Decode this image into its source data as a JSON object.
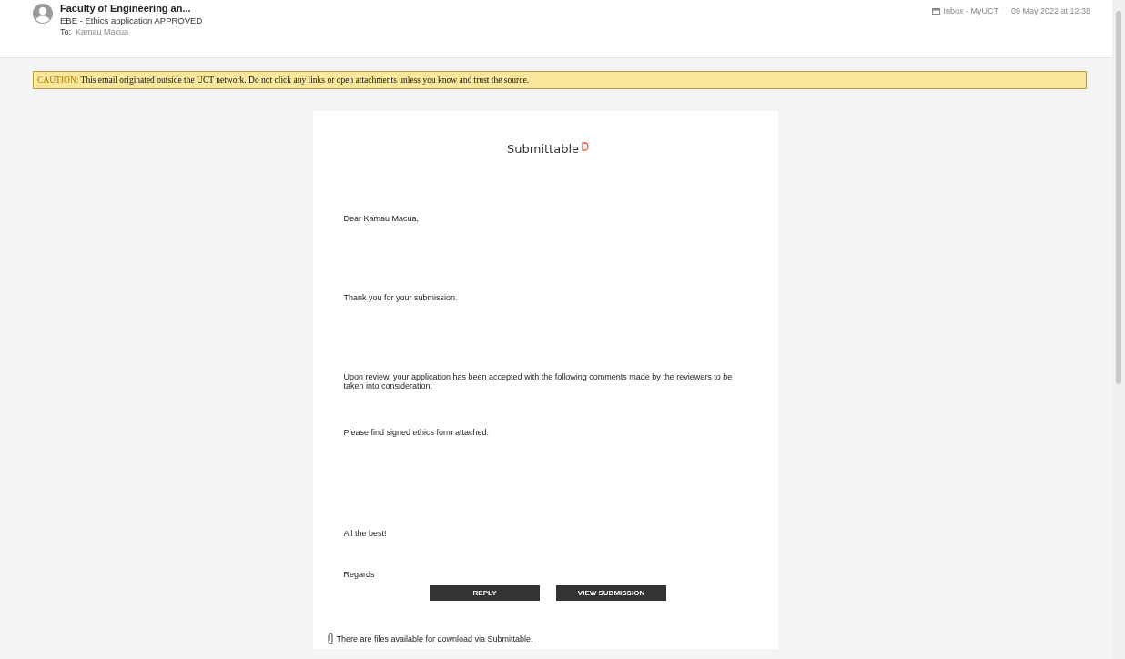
{
  "header": {
    "sender": "Faculty of Engineering an...",
    "subject": "EBE - Ethics application APPROVED",
    "to_label": "To:",
    "to_name": "Kamau Macua",
    "mailbox": "Inbox - MyUCT",
    "date": "09 May 2022 at 12:38"
  },
  "caution": {
    "label": "CAUTION:",
    "text": "This email originated outside the UCT network. Do not click any links or open attachments unless you know and trust the source."
  },
  "email": {
    "logo": "Submittable",
    "paragraphs": [
      "Dear Kamau Macua,",
      "Thank you for your submission.",
      "Upon review, your application has been accepted with the following comments made by the reviewers to be taken into consideration:",
      "Please find signed ethics form attached.",
      "All the best!",
      "Regards"
    ],
    "buttons": [
      "REPLY",
      "VIEW SUBMISSION"
    ],
    "attachment_note": "There are files available for download via Submittable."
  }
}
